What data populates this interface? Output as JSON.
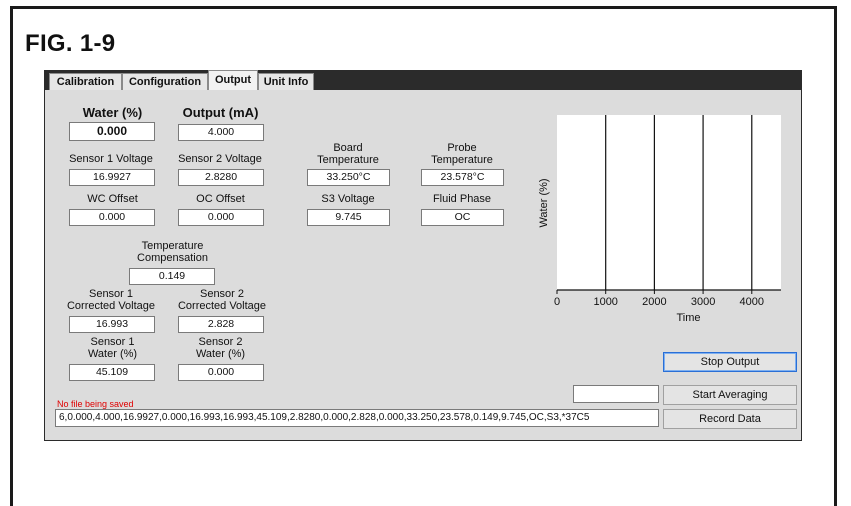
{
  "figure_title": "FIG. 1-9",
  "tabs": [
    {
      "label": "Calibration"
    },
    {
      "label": "Configuration"
    },
    {
      "label": "Output"
    },
    {
      "label": "Unit Info"
    }
  ],
  "active_tab": "Output",
  "fields": {
    "water_pct": {
      "label": "Water (%)",
      "value": "0.000"
    },
    "output_ma": {
      "label": "Output (mA)",
      "value": "4.000"
    },
    "sensor1_voltage": {
      "label": "Sensor 1 Voltage",
      "value": "16.9927"
    },
    "sensor2_voltage": {
      "label": "Sensor 2 Voltage",
      "value": "2.8280"
    },
    "board_temp": {
      "label_line1": "Board",
      "label_line2": "Temperature",
      "value": "33.250°C"
    },
    "probe_temp": {
      "label_line1": "Probe",
      "label_line2": "Temperature",
      "value": "23.578°C"
    },
    "wc_offset": {
      "label": "WC Offset",
      "value": "0.000"
    },
    "oc_offset": {
      "label": "OC Offset",
      "value": "0.000"
    },
    "s3_voltage": {
      "label": "S3 Voltage",
      "value": "9.745"
    },
    "fluid_phase": {
      "label": "Fluid Phase",
      "value": "OC"
    },
    "temp_comp": {
      "label_line1": "Temperature",
      "label_line2": "Compensation",
      "value": "0.149"
    },
    "sensor1_corr": {
      "label_line1": "Sensor 1",
      "label_line2": "Corrected Voltage",
      "value": "16.993"
    },
    "sensor2_corr": {
      "label_line1": "Sensor 2",
      "label_line2": "Corrected Voltage",
      "value": "2.828"
    },
    "sensor1_water": {
      "label_line1": "Sensor 1",
      "label_line2": "Water (%)",
      "value": "45.109"
    },
    "sensor2_water": {
      "label_line1": "Sensor 2",
      "label_line2": "Water (%)",
      "value": "0.000"
    }
  },
  "status_text": "No file being saved",
  "data_string": "6,0.000,4.000,16.9927,0.000,16.993,16.993,45.109,2.8280,0.000,2.828,0.000,33.250,23.578,0.149,9.745,OC,S3,*37C5",
  "averaging_value": "",
  "buttons": {
    "stop_output": "Stop Output",
    "start_averaging": "Start Averaging",
    "record_data": "Record Data"
  },
  "chart_data": {
    "type": "line",
    "title": "",
    "xlabel": "Time",
    "ylabel": "Water (%)",
    "xlim": [
      0,
      4600
    ],
    "x_ticks": [
      0,
      1000,
      2000,
      3000,
      4000
    ],
    "series": [],
    "vertical_gridlines": [
      1000,
      2000,
      3000,
      4000
    ],
    "grid": true
  }
}
